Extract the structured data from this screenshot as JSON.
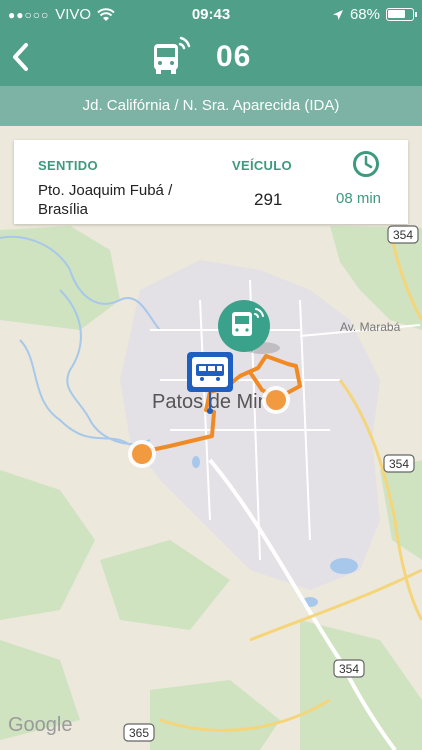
{
  "status_bar": {
    "signal_dots": "●●○○○",
    "carrier": "VIVO",
    "time": "09:43",
    "battery_percent": "68%"
  },
  "header": {
    "route_number": "06"
  },
  "route": {
    "name": "Jd. Califórnia / N. Sra. Aparecida (IDA)"
  },
  "info_card": {
    "direction_label": "SENTIDO",
    "direction_line1": "Pto. Joaquim Fubá /",
    "direction_line2": "Brasília",
    "vehicle_label": "VEÍCULO",
    "vehicle_number": "291",
    "eta": "08 min"
  },
  "map": {
    "city_label": "Patos de Min",
    "avenue_label": "Av. Marabá",
    "road_354": "354",
    "road_365": "365",
    "attribution": "Google",
    "colors": {
      "route": "#f08a24",
      "accent": "#3c9a7e",
      "stop": "#1f5fbf"
    }
  }
}
